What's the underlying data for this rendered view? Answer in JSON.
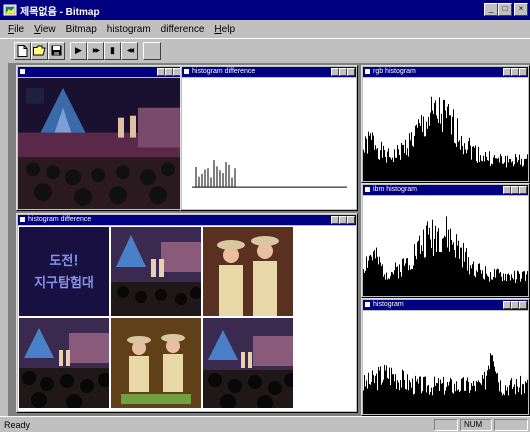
{
  "window": {
    "title": "제목없음 - Bitmap",
    "buttons": {
      "minimize": "_",
      "maximize": "□",
      "close": "×"
    }
  },
  "menu": [
    {
      "label": "File",
      "key": "F"
    },
    {
      "label": "View",
      "key": "V"
    },
    {
      "label": "Bitmap",
      "key": ""
    },
    {
      "label": "histogram",
      "key": ""
    },
    {
      "label": "difference",
      "key": ""
    },
    {
      "label": "Help",
      "key": "H"
    }
  ],
  "toolbar": {
    "new": "new-file-icon",
    "open": "open-folder-icon",
    "save": "save-disk-icon",
    "play": "▶",
    "forward": "▶▶",
    "pause": "▮",
    "rewind": "◀◀"
  },
  "children": {
    "video": {
      "title": ""
    },
    "histdiff_small": {
      "title": "histogram difference"
    },
    "rhist1": {
      "title": "rgb histogram"
    },
    "rhist2": {
      "title": "ibm histogram"
    },
    "rhist3": {
      "title": "histogram"
    },
    "frames": {
      "title": "histogram difference",
      "title_art": "도전! 지구탐험대"
    }
  },
  "status": {
    "ready": "Ready",
    "num": "NUM"
  },
  "colors": {
    "title_active": "#000080",
    "face": "#c0c0c0",
    "mdi_bg": "#808080"
  }
}
